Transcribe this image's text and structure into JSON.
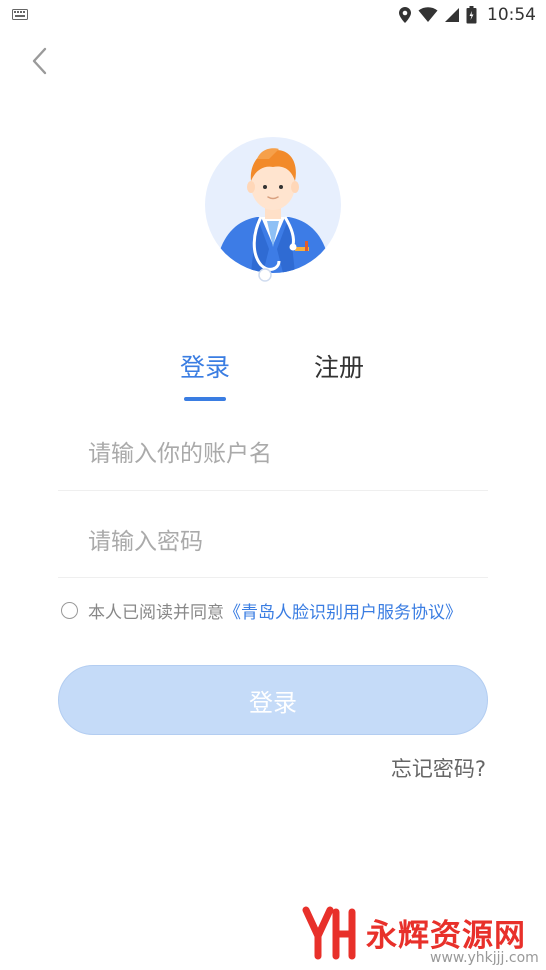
{
  "status_bar": {
    "time": "10:54",
    "icons": [
      "keyboard-icon",
      "location-icon",
      "wifi-icon",
      "signal-icon",
      "battery-icon"
    ]
  },
  "nav": {
    "back_icon": "chevron-left-icon"
  },
  "avatar": {
    "icon": "doctor-avatar-icon",
    "bg_color": "#e7effd"
  },
  "tabs": [
    {
      "label": "登录",
      "active": true
    },
    {
      "label": "注册",
      "active": false
    }
  ],
  "form": {
    "username_placeholder": "请输入你的账户名",
    "password_placeholder": "请输入密码",
    "agreement_prefix": "本人已阅读并同意",
    "agreement_link": "《青岛人脸识别用户服务协议》",
    "agreement_checked": false,
    "login_button": "登录",
    "forgot_password": "忘记密码?"
  },
  "watermark": {
    "title": "永辉资源网",
    "url": "www.yhkjjj.com"
  },
  "colors": {
    "accent": "#3a7de2",
    "button_bg": "#c5dbf8",
    "watermark": "#e8302a"
  }
}
